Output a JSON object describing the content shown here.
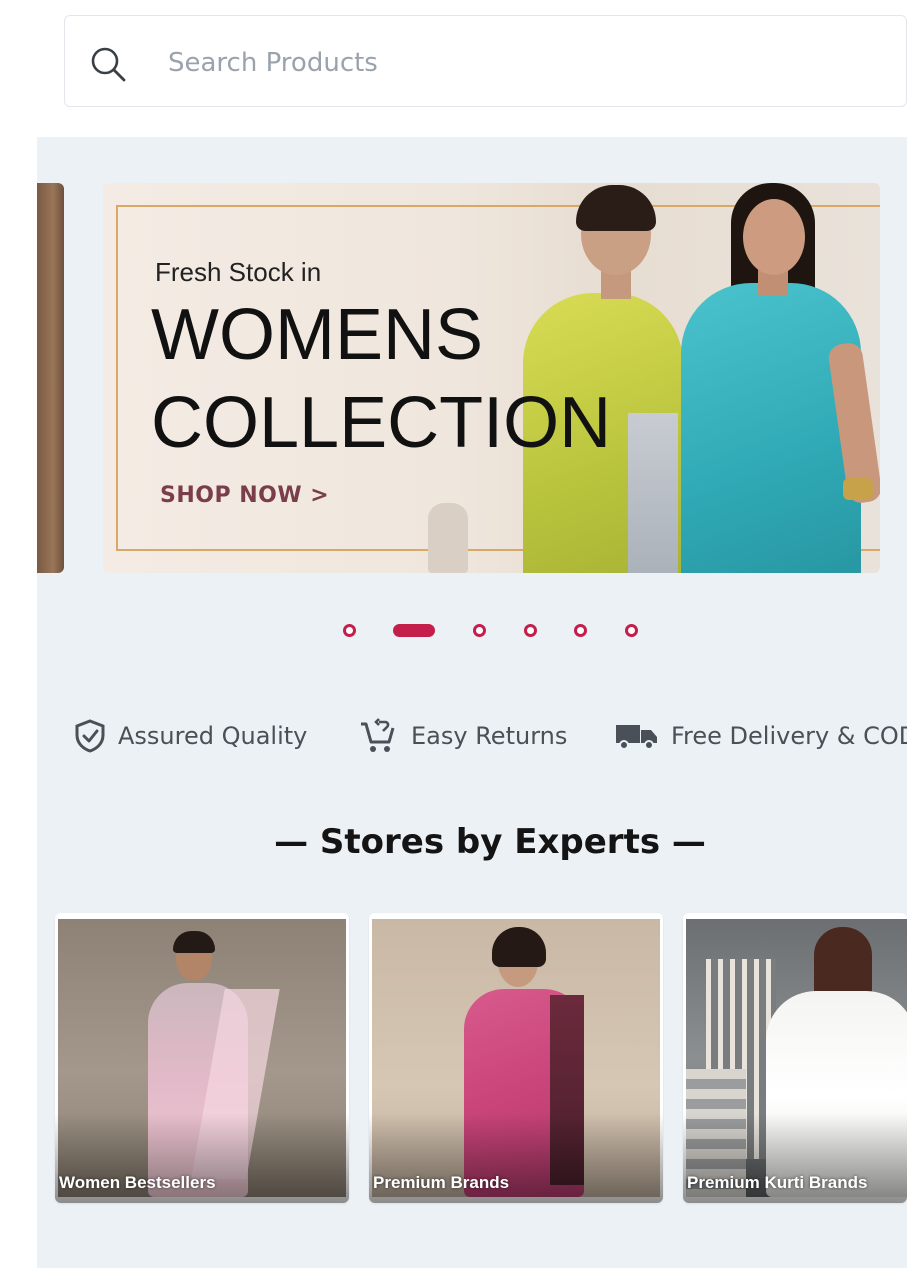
{
  "search": {
    "placeholder": "Search Products"
  },
  "banner": {
    "subtitle": "Fresh Stock in",
    "title_line1": "WOMENS",
    "title_line2": "COLLECTION",
    "cta": "SHOP NOW >"
  },
  "carousel": {
    "slide_count": 6,
    "active_index": 1,
    "accent_color": "#c41e4a"
  },
  "features": [
    {
      "icon": "shield-check-icon",
      "label": "Assured Quality"
    },
    {
      "icon": "return-cart-icon",
      "label": "Easy Returns"
    },
    {
      "icon": "delivery-truck-icon",
      "label": "Free Delivery & COD"
    }
  ],
  "stores": {
    "title": "— Stores by Experts —",
    "cards": [
      {
        "label": "Women Bestsellers"
      },
      {
        "label": "Premium Brands"
      },
      {
        "label": "Premium Kurti Brands"
      }
    ]
  }
}
